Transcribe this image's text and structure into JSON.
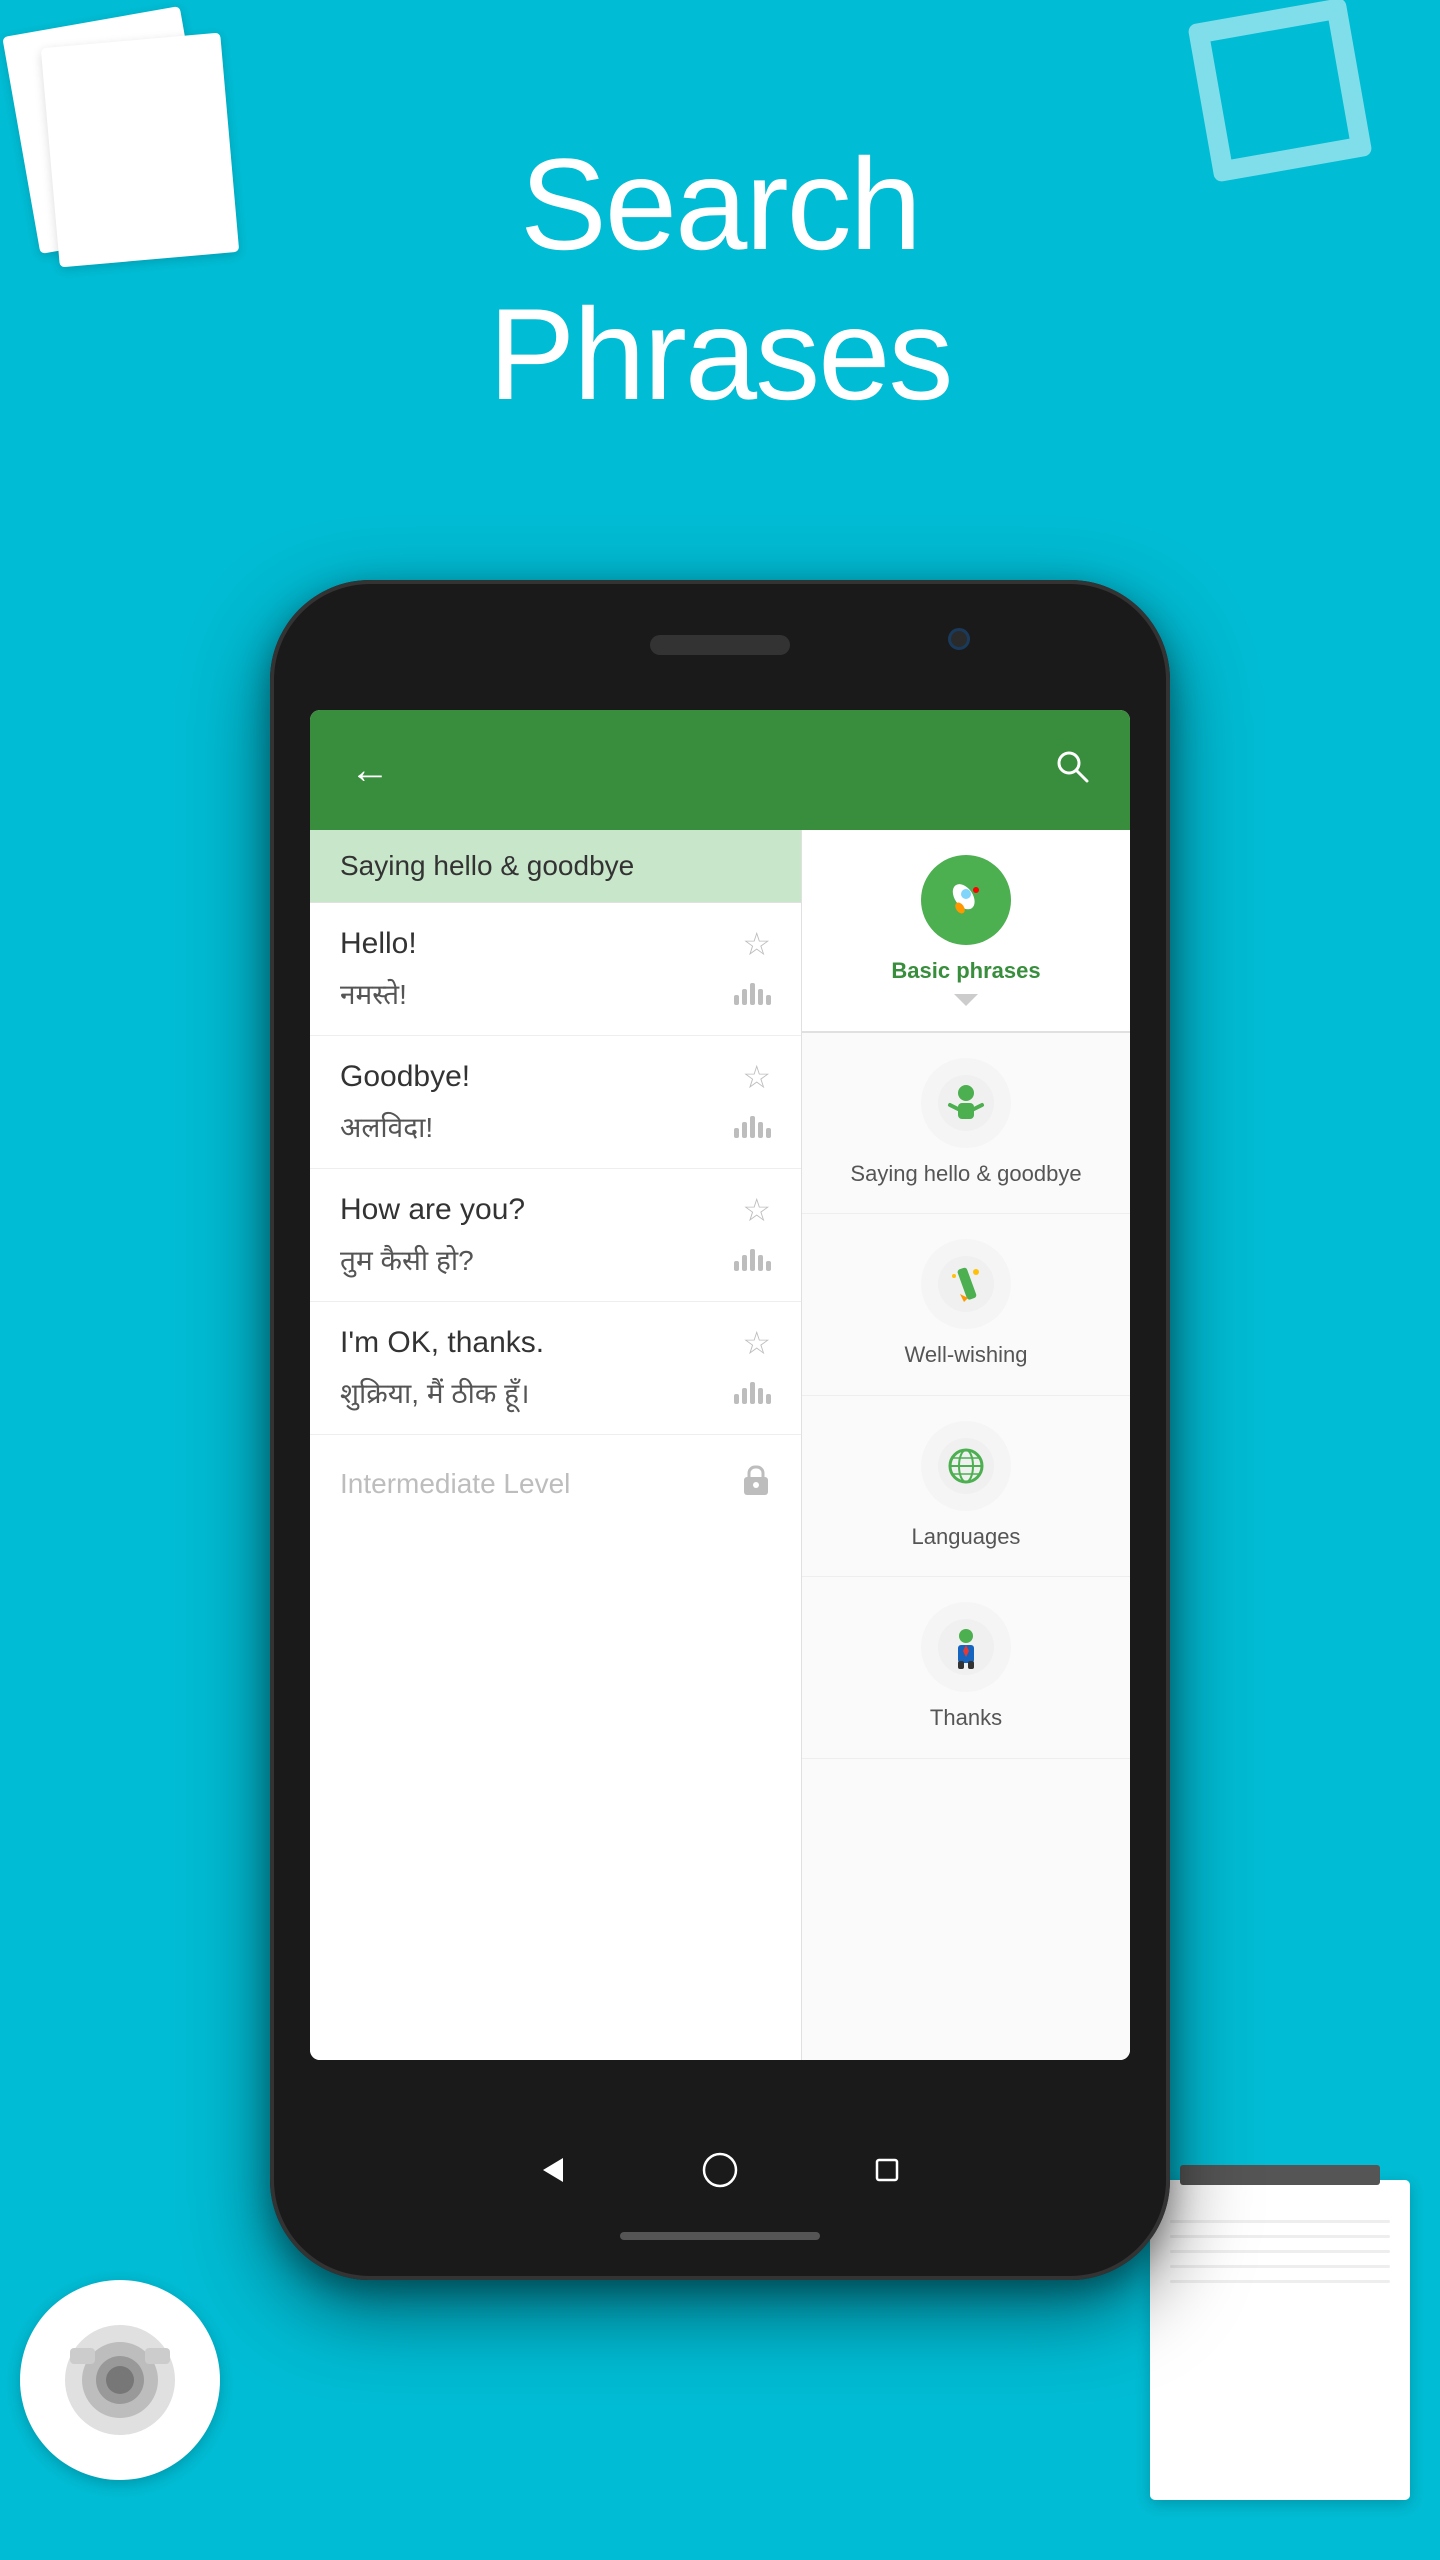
{
  "background_color": "#00BCD4",
  "heading": {
    "line1": "Search",
    "line2": "Phrases"
  },
  "app": {
    "header": {
      "back_icon": "←",
      "search_icon": "🔍"
    },
    "phrase_section": {
      "title": "Saying hello & goodbye"
    },
    "phrases": [
      {
        "english": "Hello!",
        "translation": "नमस्ते!",
        "has_star": true,
        "has_audio": true
      },
      {
        "english": "Goodbye!",
        "translation": "अलविदा!",
        "has_star": true,
        "has_audio": true
      },
      {
        "english": "How are you?",
        "translation": "तुम कैसी हो?",
        "has_star": true,
        "has_audio": true
      },
      {
        "english": "I'm OK, thanks.",
        "translation": "शुक्रिया, मैं ठीक हूँ।",
        "has_star": true,
        "has_audio": true
      }
    ],
    "locked_item": {
      "label": "Intermediate Level"
    },
    "categories": [
      {
        "id": "basic-phrases",
        "label": "Basic phrases",
        "icon": "🚀",
        "bg_color": "#4CAF50",
        "active": true
      },
      {
        "id": "saying-hello",
        "label": "Saying hello & goodbye",
        "icon": "👦",
        "bg_color": "#4CAF50",
        "active": false
      },
      {
        "id": "well-wishing",
        "label": "Well-wishing",
        "icon": "✏️",
        "bg_color": "#4CAF50",
        "active": false
      },
      {
        "id": "languages",
        "label": "Languages",
        "icon": "🌍",
        "bg_color": "#4CAF50",
        "active": false
      },
      {
        "id": "thanks",
        "label": "Thanks",
        "icon": "👔",
        "bg_color": "#4CAF50",
        "active": false
      }
    ]
  },
  "nav": {
    "back": "◁",
    "home": "○",
    "recents": "□"
  }
}
